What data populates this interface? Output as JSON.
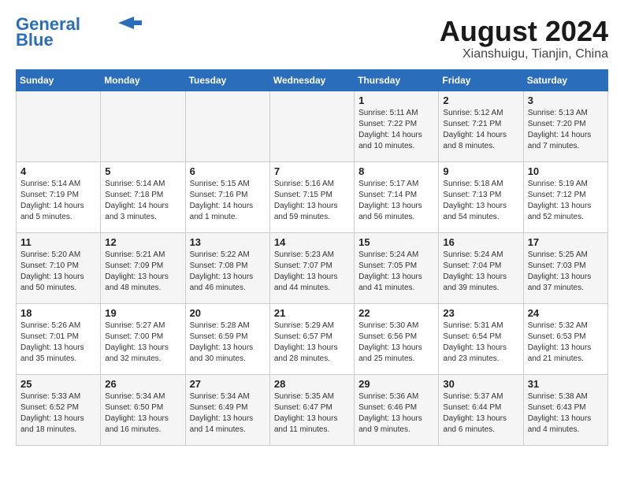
{
  "header": {
    "logo_line1": "General",
    "logo_line2": "Blue",
    "month": "August 2024",
    "location": "Xianshuigu, Tianjin, China"
  },
  "weekdays": [
    "Sunday",
    "Monday",
    "Tuesday",
    "Wednesday",
    "Thursday",
    "Friday",
    "Saturday"
  ],
  "weeks": [
    [
      {
        "day": "",
        "content": ""
      },
      {
        "day": "",
        "content": ""
      },
      {
        "day": "",
        "content": ""
      },
      {
        "day": "",
        "content": ""
      },
      {
        "day": "1",
        "content": "Sunrise: 5:11 AM\nSunset: 7:22 PM\nDaylight: 14 hours\nand 10 minutes."
      },
      {
        "day": "2",
        "content": "Sunrise: 5:12 AM\nSunset: 7:21 PM\nDaylight: 14 hours\nand 8 minutes."
      },
      {
        "day": "3",
        "content": "Sunrise: 5:13 AM\nSunset: 7:20 PM\nDaylight: 14 hours\nand 7 minutes."
      }
    ],
    [
      {
        "day": "4",
        "content": "Sunrise: 5:14 AM\nSunset: 7:19 PM\nDaylight: 14 hours\nand 5 minutes."
      },
      {
        "day": "5",
        "content": "Sunrise: 5:14 AM\nSunset: 7:18 PM\nDaylight: 14 hours\nand 3 minutes."
      },
      {
        "day": "6",
        "content": "Sunrise: 5:15 AM\nSunset: 7:16 PM\nDaylight: 14 hours\nand 1 minute."
      },
      {
        "day": "7",
        "content": "Sunrise: 5:16 AM\nSunset: 7:15 PM\nDaylight: 13 hours\nand 59 minutes."
      },
      {
        "day": "8",
        "content": "Sunrise: 5:17 AM\nSunset: 7:14 PM\nDaylight: 13 hours\nand 56 minutes."
      },
      {
        "day": "9",
        "content": "Sunrise: 5:18 AM\nSunset: 7:13 PM\nDaylight: 13 hours\nand 54 minutes."
      },
      {
        "day": "10",
        "content": "Sunrise: 5:19 AM\nSunset: 7:12 PM\nDaylight: 13 hours\nand 52 minutes."
      }
    ],
    [
      {
        "day": "11",
        "content": "Sunrise: 5:20 AM\nSunset: 7:10 PM\nDaylight: 13 hours\nand 50 minutes."
      },
      {
        "day": "12",
        "content": "Sunrise: 5:21 AM\nSunset: 7:09 PM\nDaylight: 13 hours\nand 48 minutes."
      },
      {
        "day": "13",
        "content": "Sunrise: 5:22 AM\nSunset: 7:08 PM\nDaylight: 13 hours\nand 46 minutes."
      },
      {
        "day": "14",
        "content": "Sunrise: 5:23 AM\nSunset: 7:07 PM\nDaylight: 13 hours\nand 44 minutes."
      },
      {
        "day": "15",
        "content": "Sunrise: 5:24 AM\nSunset: 7:05 PM\nDaylight: 13 hours\nand 41 minutes."
      },
      {
        "day": "16",
        "content": "Sunrise: 5:24 AM\nSunset: 7:04 PM\nDaylight: 13 hours\nand 39 minutes."
      },
      {
        "day": "17",
        "content": "Sunrise: 5:25 AM\nSunset: 7:03 PM\nDaylight: 13 hours\nand 37 minutes."
      }
    ],
    [
      {
        "day": "18",
        "content": "Sunrise: 5:26 AM\nSunset: 7:01 PM\nDaylight: 13 hours\nand 35 minutes."
      },
      {
        "day": "19",
        "content": "Sunrise: 5:27 AM\nSunset: 7:00 PM\nDaylight: 13 hours\nand 32 minutes."
      },
      {
        "day": "20",
        "content": "Sunrise: 5:28 AM\nSunset: 6:59 PM\nDaylight: 13 hours\nand 30 minutes."
      },
      {
        "day": "21",
        "content": "Sunrise: 5:29 AM\nSunset: 6:57 PM\nDaylight: 13 hours\nand 28 minutes."
      },
      {
        "day": "22",
        "content": "Sunrise: 5:30 AM\nSunset: 6:56 PM\nDaylight: 13 hours\nand 25 minutes."
      },
      {
        "day": "23",
        "content": "Sunrise: 5:31 AM\nSunset: 6:54 PM\nDaylight: 13 hours\nand 23 minutes."
      },
      {
        "day": "24",
        "content": "Sunrise: 5:32 AM\nSunset: 6:53 PM\nDaylight: 13 hours\nand 21 minutes."
      }
    ],
    [
      {
        "day": "25",
        "content": "Sunrise: 5:33 AM\nSunset: 6:52 PM\nDaylight: 13 hours\nand 18 minutes."
      },
      {
        "day": "26",
        "content": "Sunrise: 5:34 AM\nSunset: 6:50 PM\nDaylight: 13 hours\nand 16 minutes."
      },
      {
        "day": "27",
        "content": "Sunrise: 5:34 AM\nSunset: 6:49 PM\nDaylight: 13 hours\nand 14 minutes."
      },
      {
        "day": "28",
        "content": "Sunrise: 5:35 AM\nSunset: 6:47 PM\nDaylight: 13 hours\nand 11 minutes."
      },
      {
        "day": "29",
        "content": "Sunrise: 5:36 AM\nSunset: 6:46 PM\nDaylight: 13 hours\nand 9 minutes."
      },
      {
        "day": "30",
        "content": "Sunrise: 5:37 AM\nSunset: 6:44 PM\nDaylight: 13 hours\nand 6 minutes."
      },
      {
        "day": "31",
        "content": "Sunrise: 5:38 AM\nSunset: 6:43 PM\nDaylight: 13 hours\nand 4 minutes."
      }
    ]
  ]
}
